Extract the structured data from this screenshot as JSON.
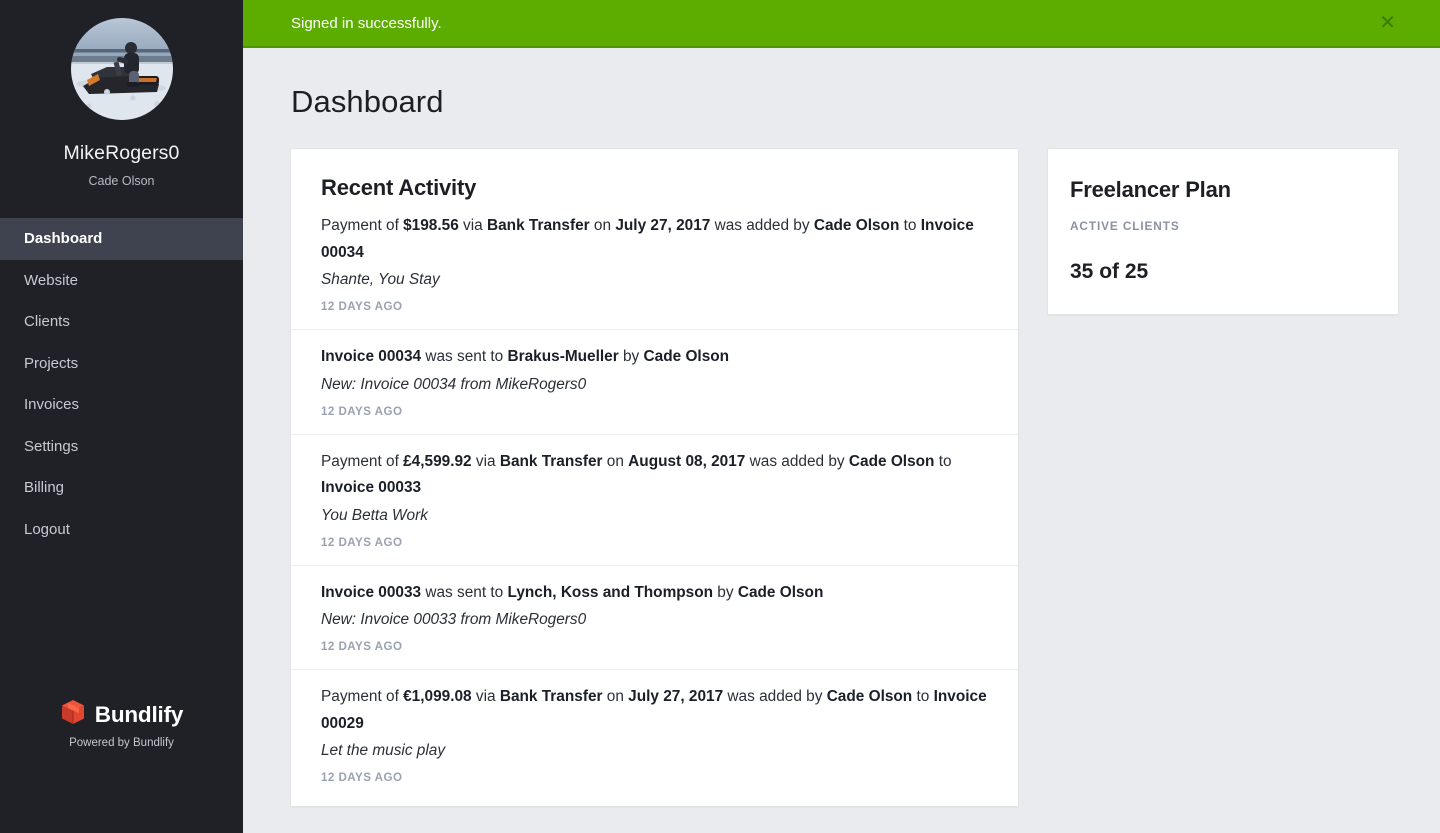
{
  "sidebar": {
    "avatar_icon": "user-avatar-snowmobile-photo",
    "profile_name": "MikeRogers0",
    "profile_subtitle": "Cade Olson",
    "nav": [
      {
        "label": "Dashboard",
        "active": true
      },
      {
        "label": "Website",
        "active": false
      },
      {
        "label": "Clients",
        "active": false
      },
      {
        "label": "Projects",
        "active": false
      },
      {
        "label": "Invoices",
        "active": false
      },
      {
        "label": "Settings",
        "active": false
      },
      {
        "label": "Billing",
        "active": false
      },
      {
        "label": "Logout",
        "active": false
      }
    ],
    "brand": {
      "logo_icon": "bundlify-cube-logo",
      "name": "Bundlify",
      "tagline": "Powered by Bundlify"
    }
  },
  "flash": {
    "message": "Signed in successfully.",
    "close_icon": "close-icon",
    "background_color": "#5cad00"
  },
  "page": {
    "title": "Dashboard"
  },
  "activity_card": {
    "title": "Recent Activity",
    "items": [
      {
        "segments": [
          {
            "text": "Payment of ",
            "bold": false
          },
          {
            "text": "$198.56",
            "bold": true
          },
          {
            "text": " via ",
            "bold": false
          },
          {
            "text": "Bank Transfer",
            "bold": true
          },
          {
            "text": " on ",
            "bold": false
          },
          {
            "text": "July 27, 2017",
            "bold": true
          },
          {
            "text": " was added by ",
            "bold": false
          },
          {
            "text": "Cade Olson",
            "bold": true
          },
          {
            "text": " to ",
            "bold": false
          },
          {
            "text": "Invoice 00034",
            "bold": true
          }
        ],
        "note": "Shante, You Stay",
        "time": "12 DAYS AGO"
      },
      {
        "segments": [
          {
            "text": "Invoice 00034",
            "bold": true
          },
          {
            "text": " was sent to ",
            "bold": false
          },
          {
            "text": "Brakus-Mueller",
            "bold": true
          },
          {
            "text": " by ",
            "bold": false
          },
          {
            "text": "Cade Olson",
            "bold": true
          }
        ],
        "note": "New: Invoice 00034 from MikeRogers0",
        "time": "12 DAYS AGO"
      },
      {
        "segments": [
          {
            "text": "Payment of ",
            "bold": false
          },
          {
            "text": "£4,599.92",
            "bold": true
          },
          {
            "text": " via ",
            "bold": false
          },
          {
            "text": "Bank Transfer",
            "bold": true
          },
          {
            "text": " on ",
            "bold": false
          },
          {
            "text": "August 08, 2017",
            "bold": true
          },
          {
            "text": " was added by ",
            "bold": false
          },
          {
            "text": "Cade Olson",
            "bold": true
          },
          {
            "text": " to ",
            "bold": false
          },
          {
            "text": "Invoice 00033",
            "bold": true
          }
        ],
        "note": "You Betta Work",
        "time": "12 DAYS AGO"
      },
      {
        "segments": [
          {
            "text": "Invoice 00033",
            "bold": true
          },
          {
            "text": " was sent to ",
            "bold": false
          },
          {
            "text": "Lynch, Koss and Thompson",
            "bold": true
          },
          {
            "text": " by ",
            "bold": false
          },
          {
            "text": "Cade Olson",
            "bold": true
          }
        ],
        "note": "New: Invoice 00033 from MikeRogers0",
        "time": "12 DAYS AGO"
      },
      {
        "segments": [
          {
            "text": "Payment of ",
            "bold": false
          },
          {
            "text": "€1,099.08",
            "bold": true
          },
          {
            "text": " via ",
            "bold": false
          },
          {
            "text": "Bank Transfer",
            "bold": true
          },
          {
            "text": " on ",
            "bold": false
          },
          {
            "text": "July 27, 2017",
            "bold": true
          },
          {
            "text": " was added by ",
            "bold": false
          },
          {
            "text": "Cade Olson",
            "bold": true
          },
          {
            "text": " to ",
            "bold": false
          },
          {
            "text": "Invoice 00029",
            "bold": true
          }
        ],
        "note": "Let the music play",
        "time": "12 DAYS AGO"
      }
    ]
  },
  "plan_card": {
    "title": "Freelancer Plan",
    "metric_label": "ACTIVE CLIENTS",
    "metric_value": "35 of 25"
  }
}
